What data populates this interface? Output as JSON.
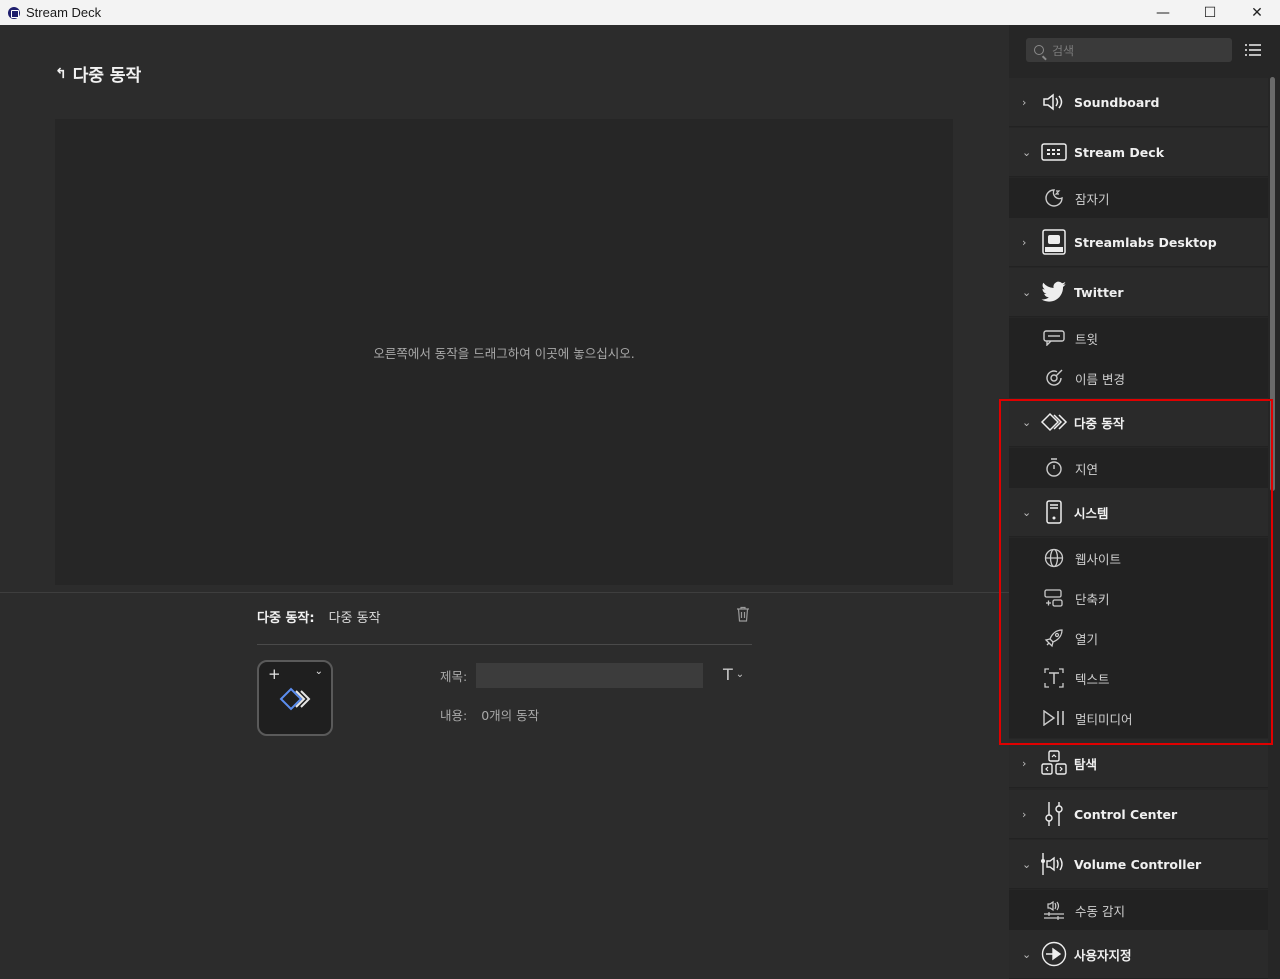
{
  "window": {
    "title": "Stream Deck",
    "minimize": "—",
    "maximize": "☐",
    "close": "✕"
  },
  "main": {
    "back_title": "다중 동작",
    "drop_hint": "오른쪽에서 동작을 드래그하여 이곳에 놓으십시오.",
    "props": {
      "label": "다중 동작:",
      "value": "다중 동작",
      "title_label": "제목:",
      "title_value": "",
      "content_label": "내용:",
      "content_value": "0개의 동작",
      "font_glyph": "T"
    }
  },
  "sidebar": {
    "search_placeholder": "검색",
    "categories": [
      {
        "label": "Soundboard",
        "expanded": false,
        "icon": "speaker-icon"
      },
      {
        "label": "Stream Deck",
        "expanded": true,
        "icon": "keypad-icon",
        "items": [
          {
            "label": "잠자기",
            "icon": "sleep-icon"
          }
        ]
      },
      {
        "label": "Streamlabs Desktop",
        "expanded": false,
        "icon": "obs-icon"
      },
      {
        "label": "Twitter",
        "expanded": true,
        "icon": "twitter-icon",
        "items": [
          {
            "label": "트윗",
            "icon": "tweet-icon"
          },
          {
            "label": "이름 변경",
            "icon": "rename-icon"
          }
        ]
      },
      {
        "label": "다중 동작",
        "expanded": true,
        "icon": "multi-action-icon",
        "items": [
          {
            "label": "지연",
            "icon": "timer-icon"
          }
        ]
      },
      {
        "label": "시스템",
        "expanded": true,
        "icon": "system-icon",
        "items": [
          {
            "label": "웹사이트",
            "icon": "globe-icon"
          },
          {
            "label": "단축키",
            "icon": "hotkey-icon"
          },
          {
            "label": "열기",
            "icon": "rocket-icon"
          },
          {
            "label": "텍스트",
            "icon": "text-icon"
          },
          {
            "label": "멀티미디어",
            "icon": "play-pause-icon"
          }
        ]
      },
      {
        "label": "탐색",
        "expanded": false,
        "icon": "navigation-icon"
      },
      {
        "label": "Control Center",
        "expanded": false,
        "icon": "sliders-icon"
      },
      {
        "label": "Volume Controller",
        "expanded": true,
        "icon": "volume-controller-icon",
        "items": [
          {
            "label": "수동 감지",
            "icon": "detect-icon"
          }
        ]
      },
      {
        "label": "사용자지정",
        "expanded": true,
        "icon": "custom-icon"
      }
    ]
  },
  "colors": {
    "highlight_border": "#e00000",
    "accent_blue": "#5b8def"
  }
}
